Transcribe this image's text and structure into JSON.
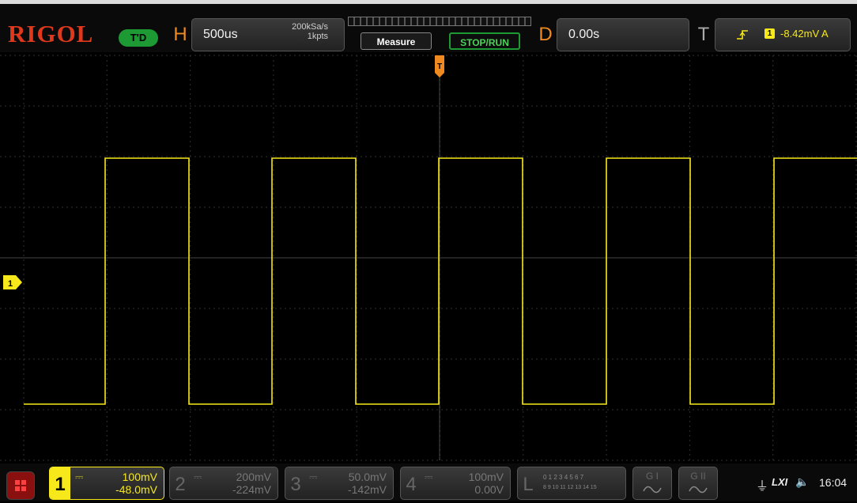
{
  "brand": "RIGOL",
  "status": "T'D",
  "horizontal": {
    "letter": "H",
    "timebase": "500us",
    "sample_rate": "200kSa/s",
    "memory_depth": "1kpts"
  },
  "buttons": {
    "measure": "Measure",
    "stop_run": "STOP/RUN"
  },
  "delay": {
    "letter": "D",
    "value": "0.00s"
  },
  "trigger": {
    "letter": "T",
    "slope_icon": "rising-edge-icon",
    "source": "1",
    "level": "-8.42mV A"
  },
  "trigger_marker": "T",
  "ch1_marker": "1",
  "channels": [
    {
      "num": "1",
      "scale": "100mV",
      "offset": "-48.0mV",
      "active": true,
      "color": "#f7e81c"
    },
    {
      "num": "2",
      "scale": "200mV",
      "offset": "-224mV",
      "active": false,
      "color": "#777777"
    },
    {
      "num": "3",
      "scale": "50.0mV",
      "offset": "-142mV",
      "active": false,
      "color": "#777777"
    },
    {
      "num": "4",
      "scale": "100mV",
      "offset": "0.00V",
      "active": false,
      "color": "#777777"
    }
  ],
  "logic": {
    "letter": "L",
    "row1": "0 1 2 3  4 5 6 7",
    "row2": "8 9 10 11 12 13 14 15"
  },
  "generators": [
    {
      "label": "G I"
    },
    {
      "label": "G II"
    }
  ],
  "status_icons": {
    "usb": "usb-icon",
    "lxi": "LXI",
    "sound": "speaker-muted-icon"
  },
  "clock": "16:04",
  "colors": {
    "ch1": "#f7e81c",
    "grid": "#3a3a3a",
    "accent": "#f08a20",
    "brand": "#e0381c",
    "run_green": "#1e9a34"
  }
}
